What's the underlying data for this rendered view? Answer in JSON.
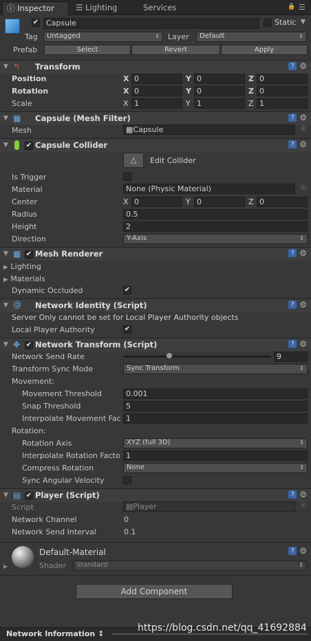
{
  "tabs": {
    "inspector": "Inspector",
    "lighting": "Lighting",
    "services": "Services"
  },
  "object": {
    "name": "Capsule",
    "static": "Static",
    "tag_label": "Tag",
    "tag_value": "Untagged",
    "layer_label": "Layer",
    "layer_value": "Default",
    "prefab_label": "Prefab",
    "select": "Select",
    "revert": "Revert",
    "apply": "Apply"
  },
  "transform": {
    "title": "Transform",
    "position": "Position",
    "rotation": "Rotation",
    "scale": "Scale",
    "x": "X",
    "y": "Y",
    "z": "Z",
    "pos": [
      "0",
      "0",
      "0"
    ],
    "rot": [
      "0",
      "0",
      "0"
    ],
    "scl": [
      "1",
      "1",
      "1"
    ]
  },
  "mesh_filter": {
    "title": "Capsule (Mesh Filter)",
    "mesh_label": "Mesh",
    "mesh_value": "Capsule"
  },
  "collider": {
    "title": "Capsule Collider",
    "edit": "Edit Collider",
    "is_trigger": "Is Trigger",
    "material": "Material",
    "material_value": "None (Physic Material)",
    "center": "Center",
    "center_vals": [
      "0",
      "0",
      "0"
    ],
    "radius": "Radius",
    "radius_value": "0.5",
    "height": "Height",
    "height_value": "2",
    "direction": "Direction",
    "direction_value": "Y-Axis"
  },
  "renderer": {
    "title": "Mesh Renderer",
    "lighting": "Lighting",
    "materials": "Materials",
    "dynamic_occluded": "Dynamic Occluded"
  },
  "net_identity": {
    "title": "Network Identity (Script)",
    "message": "Server Only cannot be set for Local Player Authority objects",
    "local_player": "Local Player Authority"
  },
  "net_transform": {
    "title": "Network Transform (Script)",
    "send_rate": "Network Send Rate",
    "send_rate_value": "9",
    "send_rate_fraction": 0.31,
    "sync_mode": "Transform Sync Mode",
    "sync_mode_value": "Sync Transform",
    "movement": "Movement:",
    "move_threshold": "Movement Threshold",
    "move_threshold_value": "0.001",
    "snap_threshold": "Snap Threshold",
    "snap_threshold_value": "5",
    "interp_move": "Interpolate Movement Fac",
    "interp_move_value": "1",
    "rotation": "Rotation:",
    "rot_axis": "Rotation Axis",
    "rot_axis_value": "XYZ (full 3D)",
    "interp_rot": "Interpolate Rotation Facto",
    "interp_rot_value": "1",
    "compress": "Compress Rotation",
    "compress_value": "None",
    "sync_angular": "Sync Angular Velocity"
  },
  "player": {
    "title": "Player (Script)",
    "script": "Script",
    "script_value": "Player",
    "channel": "Network Channel",
    "channel_value": "0",
    "interval": "Network Send Interval",
    "interval_value": "0.1"
  },
  "material": {
    "name": "Default-Material",
    "shader": "Shader",
    "shader_value": "Standard"
  },
  "add_component": "Add Component",
  "footer": {
    "label": "Network Information",
    "watermark": "https://blog.csdn.net/qq_41692884"
  }
}
